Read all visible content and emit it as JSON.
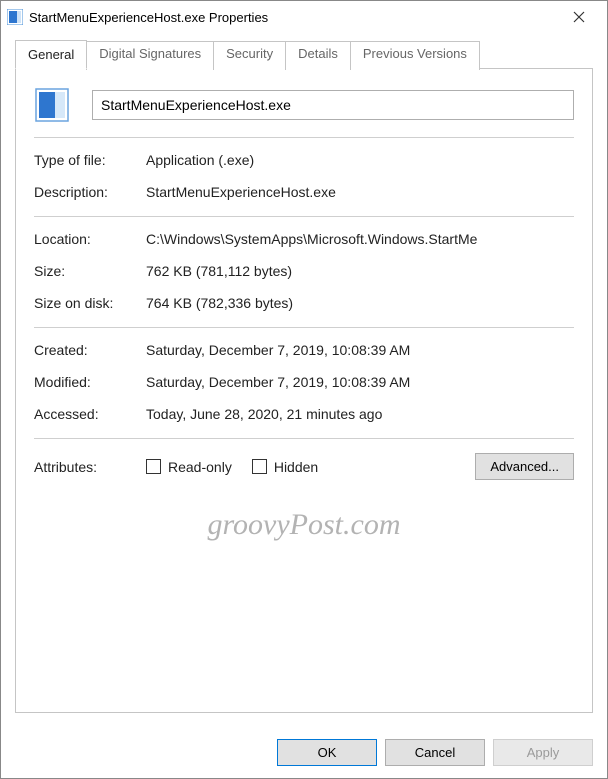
{
  "window": {
    "title": "StartMenuExperienceHost.exe Properties"
  },
  "tabs": {
    "general": "General",
    "digitalSignatures": "Digital Signatures",
    "security": "Security",
    "details": "Details",
    "previousVersions": "Previous Versions"
  },
  "file": {
    "name": "StartMenuExperienceHost.exe"
  },
  "labels": {
    "typeOfFile": "Type of file:",
    "description": "Description:",
    "location": "Location:",
    "size": "Size:",
    "sizeOnDisk": "Size on disk:",
    "created": "Created:",
    "modified": "Modified:",
    "accessed": "Accessed:",
    "attributes": "Attributes:",
    "readOnly": "Read-only",
    "hidden": "Hidden",
    "advanced": "Advanced...",
    "ok": "OK",
    "cancel": "Cancel",
    "apply": "Apply"
  },
  "values": {
    "typeOfFile": "Application (.exe)",
    "description": "StartMenuExperienceHost.exe",
    "location": "C:\\Windows\\SystemApps\\Microsoft.Windows.StartMe",
    "size": "762 KB (781,112 bytes)",
    "sizeOnDisk": "764 KB (782,336 bytes)",
    "created": "Saturday, December 7, 2019, 10:08:39 AM",
    "modified": "Saturday, December 7, 2019, 10:08:39 AM",
    "accessed": "Today, June 28, 2020, 21 minutes ago"
  },
  "watermark": "groovyPost.com"
}
